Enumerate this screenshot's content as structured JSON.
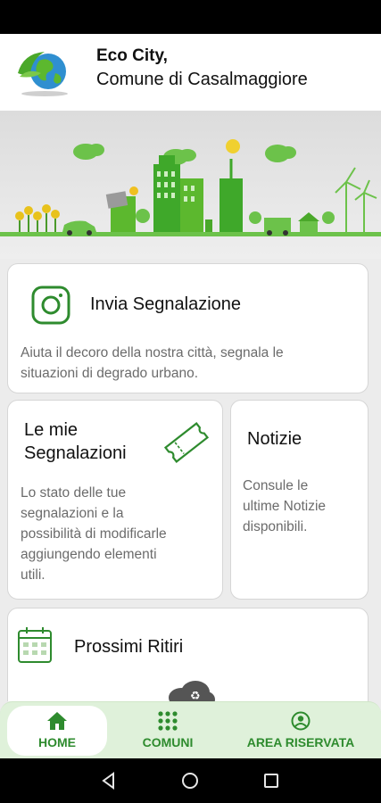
{
  "header": {
    "title_line1": "Eco City,",
    "title_line2": "Comune di Casalmaggiore"
  },
  "cards": {
    "report": {
      "title": "Invia Segnalazione",
      "description_line1": "Aiuta il decoro della nostra città, segnala le",
      "description_line2": "situazioni di degrado urbano."
    },
    "my_reports": {
      "title_line1": "Le mie",
      "title_line2": "Segnalazioni",
      "description": [
        "Lo stato delle tue",
        "segnalazioni e la",
        "possibilità di modificarle",
        "aggiungendo elementi",
        "utili."
      ]
    },
    "news": {
      "title": "Notizie",
      "description": [
        "Consule le",
        "ultime Notizie",
        "disponibili."
      ]
    },
    "pickups": {
      "title": "Prossimi Ritiri"
    }
  },
  "nav": {
    "home": "HOME",
    "comuni": "COMUNI",
    "reserved": "AREA RISERVATA"
  },
  "colors": {
    "accent": "#2e8b2e",
    "nav_bg": "#dff1da"
  }
}
